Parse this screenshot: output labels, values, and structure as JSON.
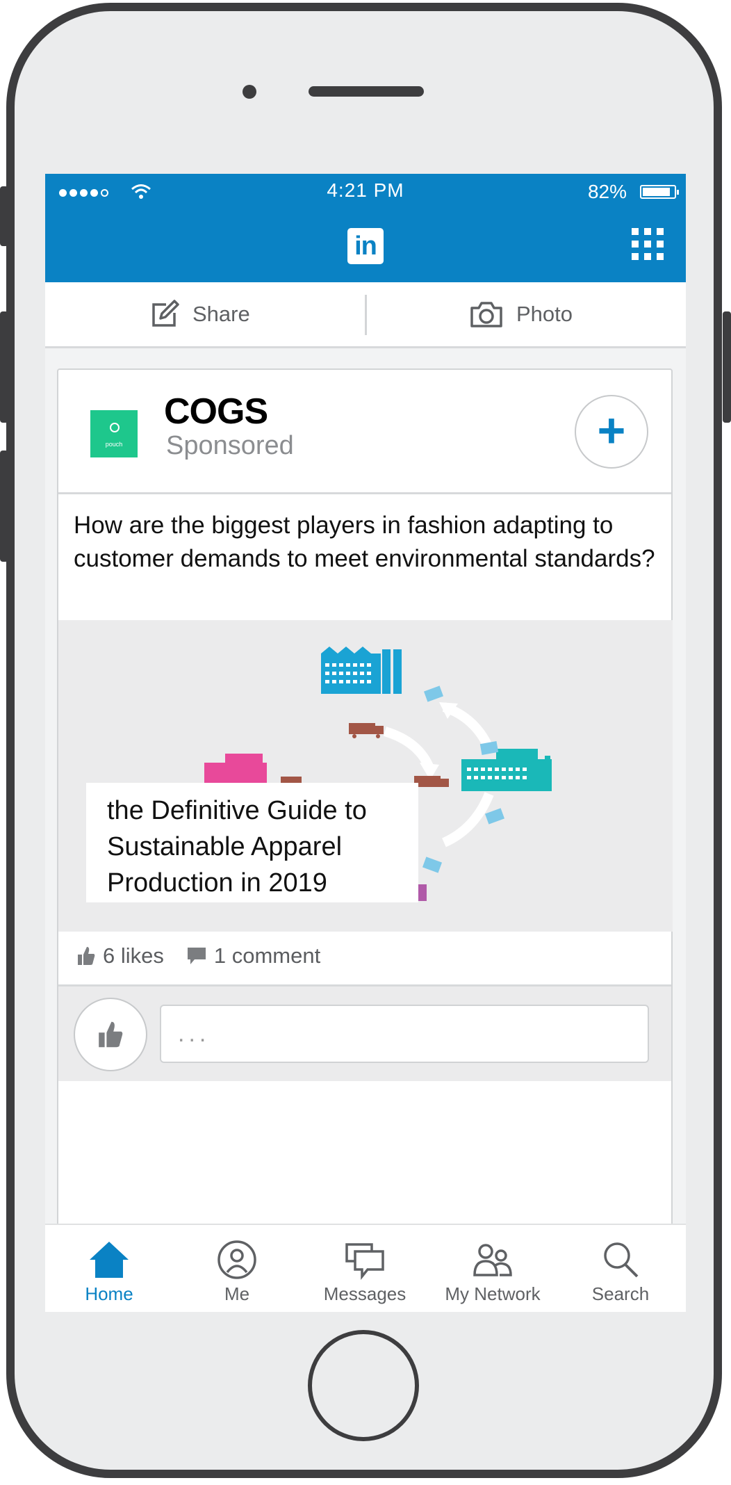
{
  "status_bar": {
    "time": "4:21 PM",
    "battery": "82%"
  },
  "header": {
    "logo": "in"
  },
  "share_bar": {
    "share_label": "Share",
    "photo_label": "Photo"
  },
  "post": {
    "company": "COGS",
    "logo_text": "pouch",
    "sponsored": "Sponsored",
    "text": "How are the biggest players in fashion adapting to customer demands to meet environmental standards?",
    "image_caption": "the Definitive Guide to Sustainable Apparel Production in 2019",
    "likes": "6 likes",
    "comments": "1 comment",
    "comment_placeholder": "..."
  },
  "nav": {
    "items": [
      {
        "label": "Home",
        "icon": "home-icon",
        "active": true
      },
      {
        "label": "Me",
        "icon": "profile-icon"
      },
      {
        "label": "Messages",
        "icon": "messages-icon"
      },
      {
        "label": "My Network",
        "icon": "network-icon"
      },
      {
        "label": "Search",
        "icon": "search-icon"
      }
    ]
  },
  "colors": {
    "brand": "#0a82c4",
    "logo_green": "#1ec78c",
    "frame": "#3d3d3f"
  }
}
